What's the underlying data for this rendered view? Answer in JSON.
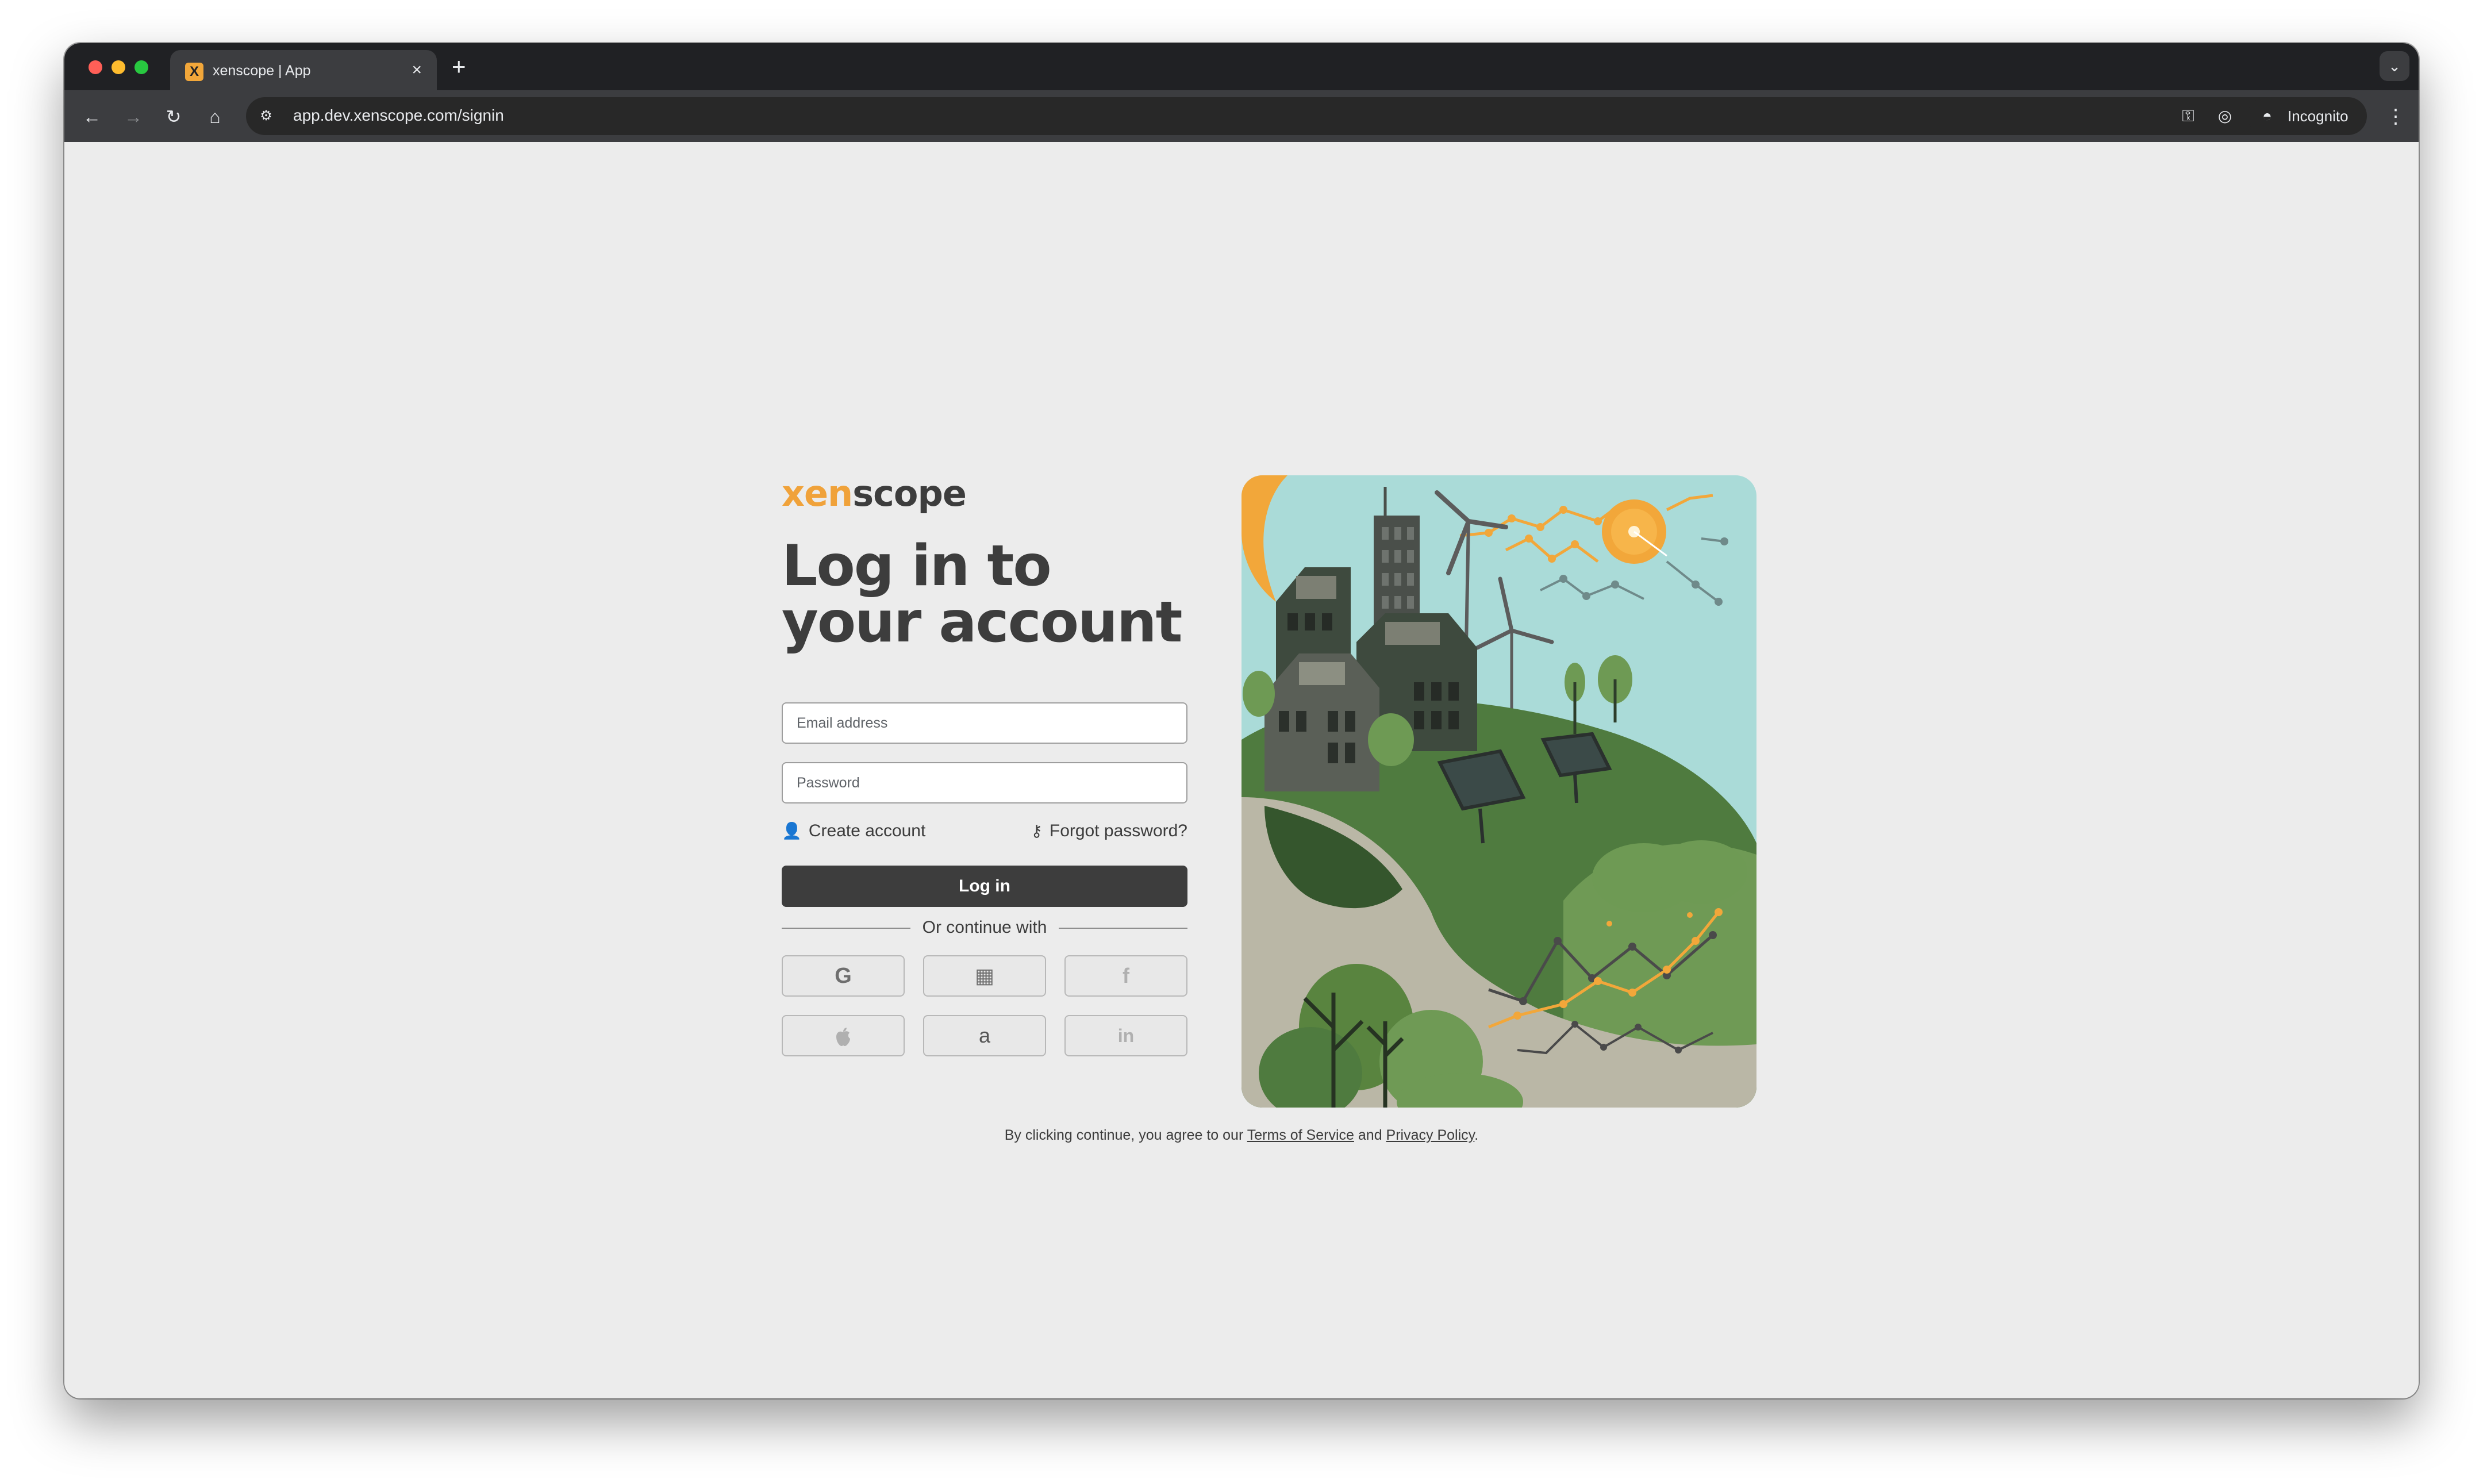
{
  "browser": {
    "tab": {
      "title": "xenscope | App",
      "favicon_char": "X",
      "close_label": "×"
    },
    "new_tab_label": "+",
    "tab_search_label": "⌄",
    "toolbar": {
      "back_label": "←",
      "forward_label": "→",
      "reload_label": "↻",
      "home_label": "⌂",
      "site_info_label": "⚙",
      "url": "app.dev.xenscope.com/signin",
      "key_icon_label": "⚿",
      "eye_icon_label": "◎",
      "star_icon_label": "☆",
      "incognito_icon_label": "◓",
      "incognito_label": "Incognito",
      "menu_label": "⋮"
    }
  },
  "login": {
    "logo": {
      "part1": "xen",
      "part2": "scope"
    },
    "heading": "Log in to your account",
    "email_placeholder": "Email address",
    "password_placeholder": "Password",
    "create_account": "Create account",
    "create_icon": "👤",
    "forgot_password": "Forgot password?",
    "forgot_icon": "⚷",
    "login_button": "Log in",
    "divider_text": "Or continue with",
    "social": [
      {
        "name": "google",
        "glyph": "G"
      },
      {
        "name": "microsoft",
        "glyph": "▦"
      },
      {
        "name": "facebook",
        "glyph": "f"
      },
      {
        "name": "apple",
        "glyph": ""
      },
      {
        "name": "amazon",
        "glyph": "a"
      },
      {
        "name": "linkedin",
        "glyph": "in"
      }
    ]
  },
  "terms": {
    "prefix": "By clicking continue, you agree to our ",
    "tos": "Terms of Service",
    "middle": " and ",
    "privacy": "Privacy Policy",
    "suffix": "."
  },
  "colors": {
    "accent": "#f0a23a",
    "text_dark": "#3d3d3d",
    "button_bg": "#3d3d3d",
    "page_bg": "#ececec"
  }
}
